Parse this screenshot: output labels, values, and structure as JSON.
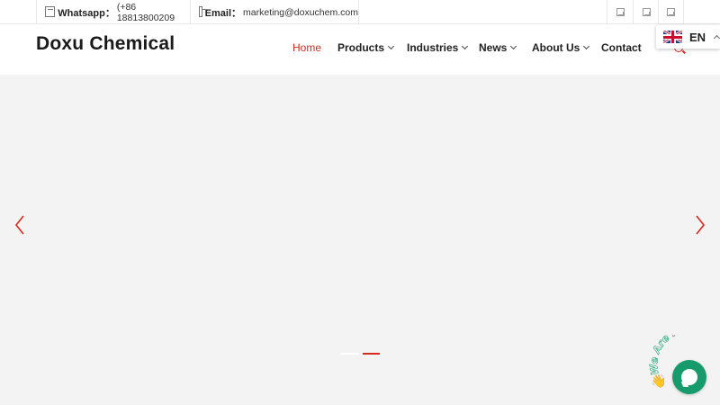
{
  "topbar": {
    "whatsapp_label": "Whatsapp：",
    "whatsapp_value": "(+86 18813800209",
    "email_label": "Email：",
    "email_value": "marketing@doxuchem.com",
    "social_icons": [
      "social-icon-1",
      "social-icon-2",
      "social-icon-3"
    ]
  },
  "header": {
    "logo": "Doxu Chemical",
    "nav": [
      {
        "label": "Home",
        "active": true,
        "dropdown": false
      },
      {
        "label": "Products",
        "active": false,
        "dropdown": true
      },
      {
        "label": "Industries",
        "active": false,
        "dropdown": true
      },
      {
        "label": "News",
        "active": false,
        "dropdown": true
      },
      {
        "label": "About Us",
        "active": false,
        "dropdown": true
      },
      {
        "label": "Contact",
        "active": false,
        "dropdown": false
      }
    ]
  },
  "language": {
    "code": "EN",
    "flag": "uk-flag-icon"
  },
  "slider": {
    "active_slide": 2,
    "slide_count": 2,
    "prev_icon": "chevron-left-icon",
    "next_icon": "chevron-right-icon"
  },
  "chat": {
    "badge_text": "We Are Here!",
    "icon": "chat-bubble-icon"
  },
  "colors": {
    "accent": "#d42a1f",
    "hero_bg": "#f3f3f3",
    "chat_green": "#179a6c"
  }
}
